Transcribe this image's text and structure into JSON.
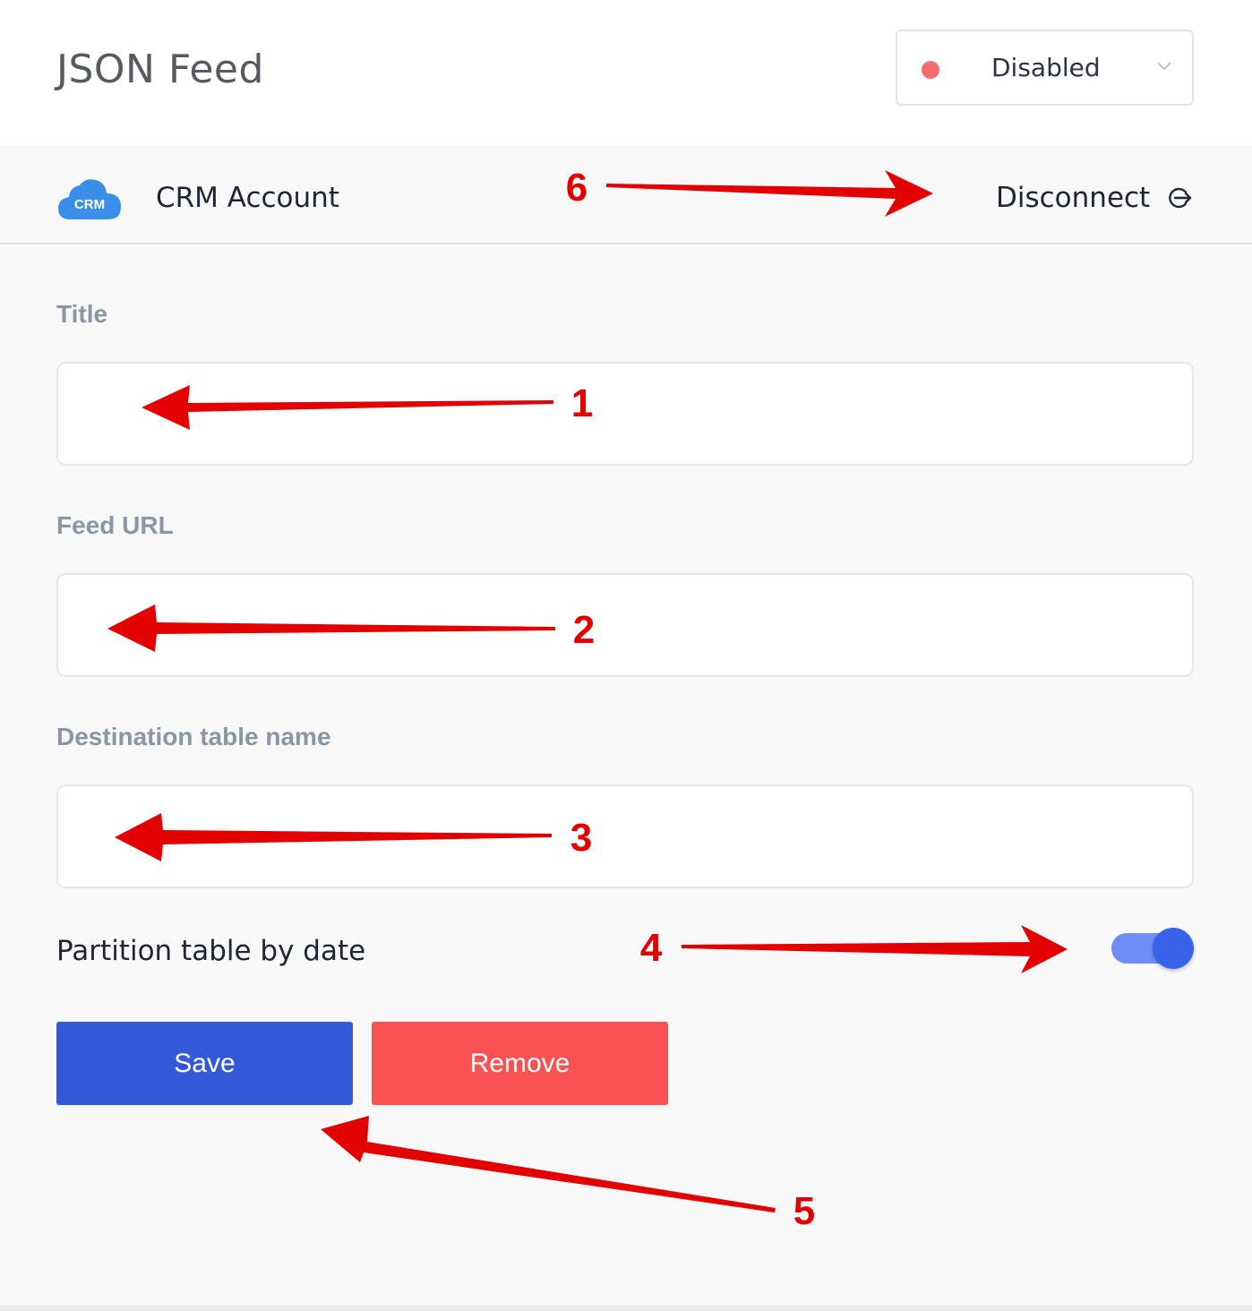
{
  "header": {
    "title": "JSON Feed",
    "status": {
      "label": "Disabled",
      "dot_color": "#f56c6c",
      "icon": "chevron-down-icon"
    }
  },
  "account": {
    "icon_text": "CRM",
    "name": "CRM Account",
    "disconnect_label": "Disconnect",
    "disconnect_icon": "logout-icon"
  },
  "form": {
    "title_label": "Title",
    "title_value": "",
    "url_label": "Feed URL",
    "url_value": "",
    "table_label": "Destination table name",
    "table_value": "",
    "partition_label": "Partition table by date",
    "partition_enabled": true
  },
  "buttons": {
    "save": "Save",
    "remove": "Remove"
  },
  "colors": {
    "primary": "#3359d8",
    "danger": "#fa5252",
    "toggle": "#3763ea",
    "annotation": "#e30000"
  },
  "annotations": [
    "1",
    "2",
    "3",
    "4",
    "5",
    "6"
  ]
}
